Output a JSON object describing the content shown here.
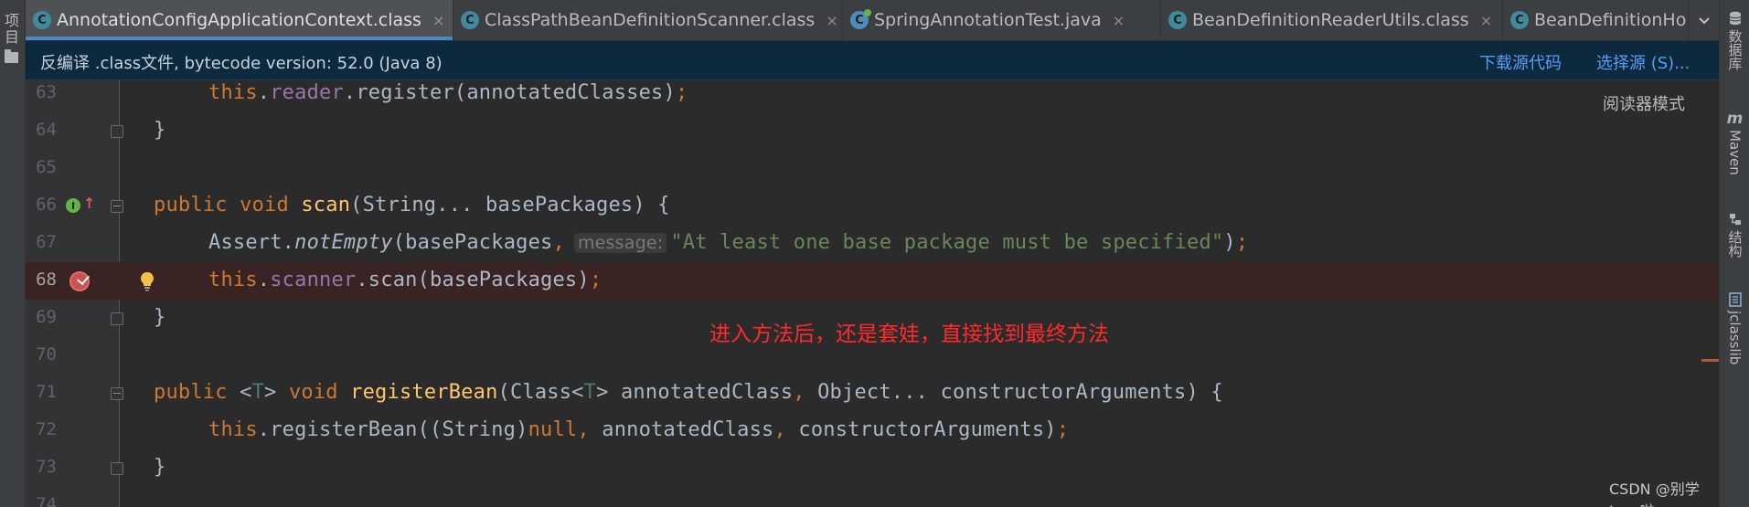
{
  "left_tool": {
    "label": "项目"
  },
  "right_tools": [
    {
      "label": "数据库",
      "icon": "database-icon"
    },
    {
      "label": "Maven",
      "icon": "maven-icon"
    },
    {
      "label": "结构",
      "icon": "structure-icon"
    },
    {
      "label": "jclasslib",
      "icon": "jclasslib-icon"
    }
  ],
  "tabs": [
    {
      "label": "AnnotationConfigApplicationContext.class",
      "icon": "class-file-icon",
      "active": true,
      "close": "×"
    },
    {
      "label": "ClassPathBeanDefinitionScanner.class",
      "icon": "class-file-icon",
      "active": false,
      "close": "×"
    },
    {
      "label": "SpringAnnotationTest.java",
      "icon": "java-file-icon",
      "active": false,
      "close": "×"
    },
    {
      "label": "BeanDefinitionReaderUtils.class",
      "icon": "class-file-icon",
      "active": false,
      "close": "×"
    },
    {
      "label": "BeanDefinitionHold",
      "icon": "class-file-icon",
      "active": false,
      "close": ""
    }
  ],
  "banner": {
    "message": "反编译 .class文件, bytecode version: 52.0 (Java 8)",
    "download_source": "下载源代码",
    "choose_source": "选择源 (S)..."
  },
  "reader_mode": "阅读器模式",
  "annotation": "进入方法后，还是套娃，直接找到最终方法",
  "watermark": "CSDN @别学Java啦",
  "code": {
    "l63": {
      "num": "63",
      "kw_this": "this",
      "dot1": ".",
      "field": "reader",
      "rest": ".register(annotatedClasses)",
      "semi": ";"
    },
    "l64": {
      "num": "64",
      "brace": "}"
    },
    "l65": {
      "num": "65"
    },
    "l66": {
      "num": "66",
      "kw1": "public",
      "kw2": "void",
      "fn": "scan",
      "rest": "(String... basePackages) {"
    },
    "l67": {
      "num": "67",
      "cls": "Assert.",
      "method": "notEmpty",
      "args": "(basePackages",
      "comma": ",",
      "hint": "message:",
      "str": "\"At least one base package must be specified\"",
      "close": ")",
      "semi": ";"
    },
    "l68": {
      "num": "68",
      "kw_this": "this",
      "dot1": ".",
      "field": "scanner",
      "rest": ".scan(basePackages)",
      "semi": ";"
    },
    "l69": {
      "num": "69",
      "brace": "}"
    },
    "l70": {
      "num": "70"
    },
    "l71": {
      "num": "71",
      "kw1": "public",
      "lt": "<",
      "tp": "T",
      "gt": ">",
      "kw2": "void",
      "fn": "registerBean",
      "p1": "(Class<",
      "tp2": "T",
      "p2": "> annotatedClass",
      "comma": ",",
      "p3": " Object... constructorArguments) {"
    },
    "l72": {
      "num": "72",
      "kw_this": "this",
      "p1": ".registerBean((String)",
      "kw_null": "null",
      "comma": ",",
      "p2": " annotatedClass",
      "comma2": ",",
      "p3": " constructorArguments)",
      "semi": ";"
    },
    "l73": {
      "num": "73",
      "brace": "}"
    },
    "l74": {
      "num": "74"
    }
  }
}
